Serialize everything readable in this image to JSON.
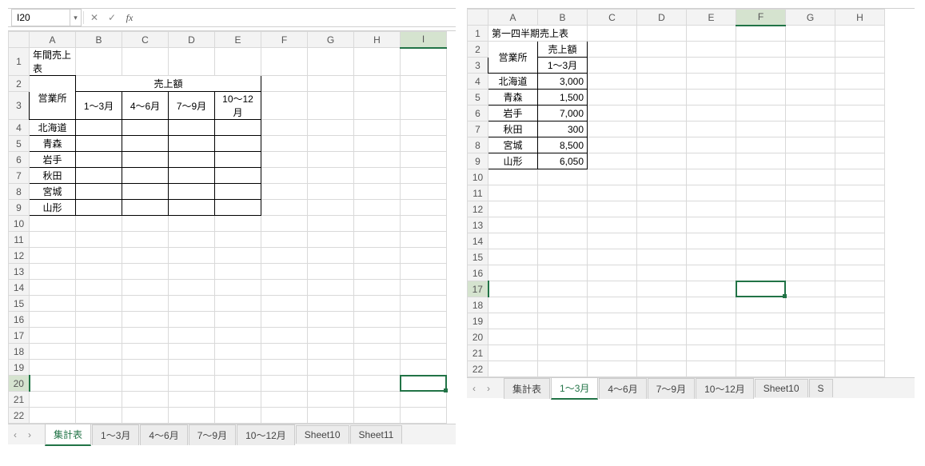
{
  "left": {
    "namebox": "I20",
    "cols": [
      "A",
      "B",
      "C",
      "D",
      "E",
      "F",
      "G",
      "H",
      "I"
    ],
    "row_count": 22,
    "title": "年間売上表",
    "rowLabel": "営業所",
    "salesHdr": "売上額",
    "periods": [
      "1～3月",
      "4～6月",
      "7～9月",
      "10～12月"
    ],
    "offices": [
      "北海道",
      "青森",
      "岩手",
      "秋田",
      "宮城",
      "山形"
    ],
    "tabs": [
      "集計表",
      "1～3月",
      "4～6月",
      "7～9月",
      "10～12月",
      "Sheet10",
      "Sheet11"
    ],
    "activeTab": 0,
    "selected": {
      "row": 20,
      "col": 8
    }
  },
  "right": {
    "cols": [
      "A",
      "B",
      "C",
      "D",
      "E",
      "F",
      "G",
      "H"
    ],
    "row_count": 22,
    "title": "第一四半期売上表",
    "rowLabel": "営業所",
    "salesHdr": "売上額",
    "period": "1～3月",
    "rows": [
      {
        "office": "北海道",
        "value": "3,000"
      },
      {
        "office": "青森",
        "value": "1,500"
      },
      {
        "office": "岩手",
        "value": "7,000"
      },
      {
        "office": "秋田",
        "value": "300"
      },
      {
        "office": "宮城",
        "value": "8,500"
      },
      {
        "office": "山形",
        "value": "6,050"
      }
    ],
    "tabs": [
      "集計表",
      "1～3月",
      "4～6月",
      "7～9月",
      "10～12月",
      "Sheet10",
      "S"
    ],
    "activeTab": 1,
    "selected": {
      "row": 17,
      "col": 5
    }
  },
  "nav": {
    "prev": "‹",
    "next": "›"
  }
}
